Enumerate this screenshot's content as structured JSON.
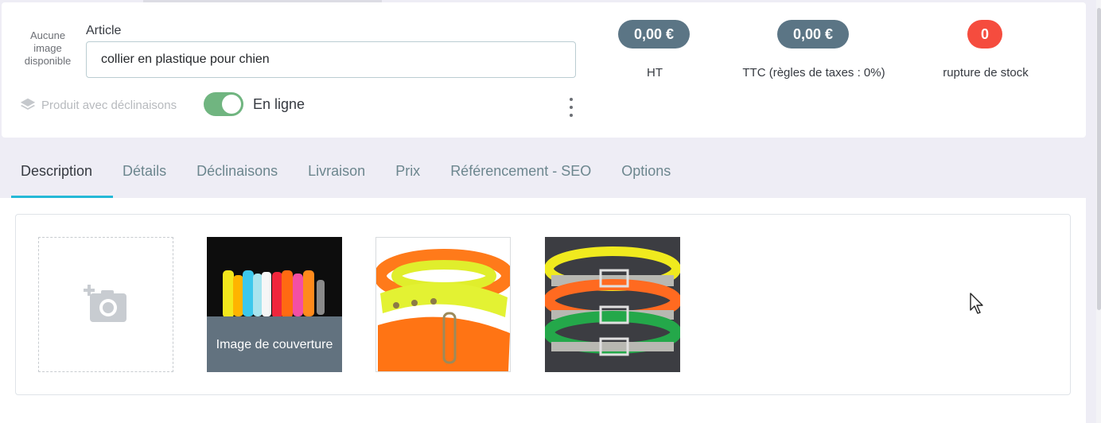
{
  "header": {
    "no_image_text": "Aucune image disponible",
    "article_label": "Article",
    "product_name": "collier en plastique pour chien",
    "variants_label": "Produit avec déclinaisons",
    "online_label": "En ligne",
    "online_enabled": true,
    "price_ht": "0,00 €",
    "price_ht_label": "HT",
    "price_ttc": "0,00 €",
    "price_ttc_label": "TTC (règles de taxes : 0%)",
    "stock_value": "0",
    "stock_label": "rupture de stock"
  },
  "tabs": [
    {
      "label": "Description",
      "active": true
    },
    {
      "label": "Détails",
      "active": false
    },
    {
      "label": "Déclinaisons",
      "active": false
    },
    {
      "label": "Livraison",
      "active": false
    },
    {
      "label": "Prix",
      "active": false
    },
    {
      "label": "Référencement - SEO",
      "active": false
    },
    {
      "label": "Options",
      "active": false
    }
  ],
  "images": {
    "cover_label": "Image de couverture",
    "add_icon": "add-photo-icon"
  },
  "colors": {
    "accent": "#25b9d7",
    "pill": "#5b7585",
    "danger": "#f54c3e",
    "toggle_on": "#70b580"
  }
}
